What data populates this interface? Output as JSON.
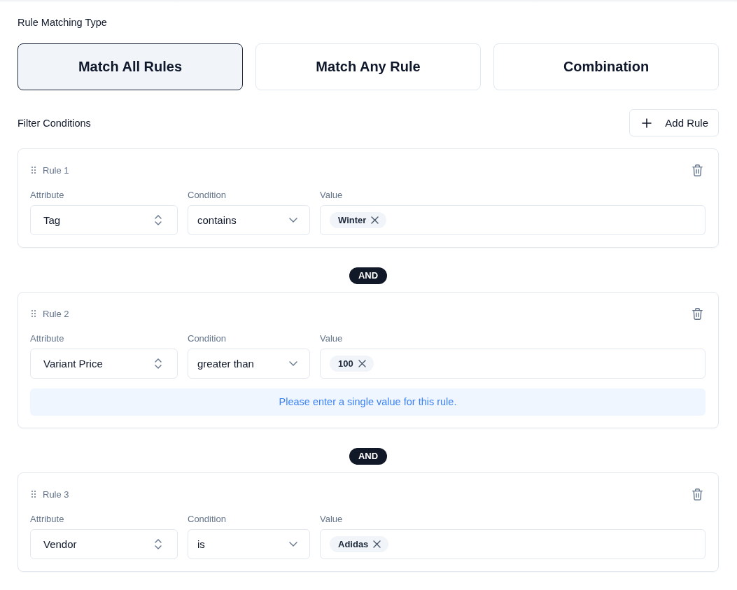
{
  "matching": {
    "label": "Rule Matching Type",
    "options": [
      {
        "label": "Match All Rules",
        "selected": true
      },
      {
        "label": "Match Any Rule",
        "selected": false
      },
      {
        "label": "Combination",
        "selected": false
      }
    ]
  },
  "filters": {
    "title": "Filter Conditions",
    "add_button": "Add Rule",
    "rules": [
      {
        "title": "Rule 1",
        "attribute": {
          "label": "Attribute",
          "value": "Tag"
        },
        "condition": {
          "label": "Condition",
          "value": "contains"
        },
        "value": {
          "label": "Value",
          "tags": [
            "Winter"
          ]
        }
      },
      {
        "connector": "AND",
        "title": "Rule 2",
        "attribute": {
          "label": "Attribute",
          "value": "Variant Price"
        },
        "condition": {
          "label": "Condition",
          "value": "greater than"
        },
        "value": {
          "label": "Value",
          "tags": [
            "100"
          ]
        },
        "message": "Please enter a single value for this rule."
      },
      {
        "connector": "AND",
        "title": "Rule 3",
        "attribute": {
          "label": "Attribute",
          "value": "Vendor"
        },
        "condition": {
          "label": "Condition",
          "value": "is"
        },
        "value": {
          "label": "Value",
          "tags": [
            "Adidas"
          ]
        }
      }
    ]
  }
}
